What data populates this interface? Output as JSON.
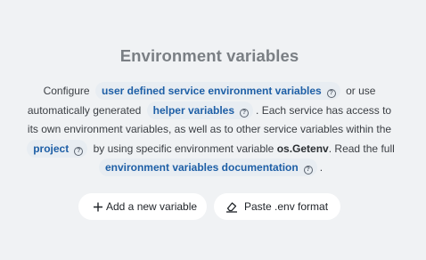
{
  "empty_state": {
    "title": "Environment variables",
    "description": {
      "t1": "Configure",
      "link_user_defined": "user defined service environment variables",
      "t2": "or use automatically generated",
      "link_helper": "helper variables",
      "t3": ". Each service has access to its own environment variables, as well as to other service variables within the",
      "link_project": "project",
      "t4": "by using specific environment variable",
      "code": "os.Getenv",
      "t5": ". Read the full",
      "link_docs": "environment variables documentation",
      "t6": "."
    },
    "help_glyph": "?",
    "actions": {
      "add_label": "Add a new variable",
      "paste_label": "Paste .env format"
    },
    "icons": {
      "add": "plus-icon",
      "paste": "eraser-icon",
      "help": "help-circle-icon"
    },
    "colors": {
      "background": "#f0f2f4",
      "link": "#1e5fa6",
      "pill_background": "#e8edf2",
      "title": "#7a7f84"
    }
  }
}
